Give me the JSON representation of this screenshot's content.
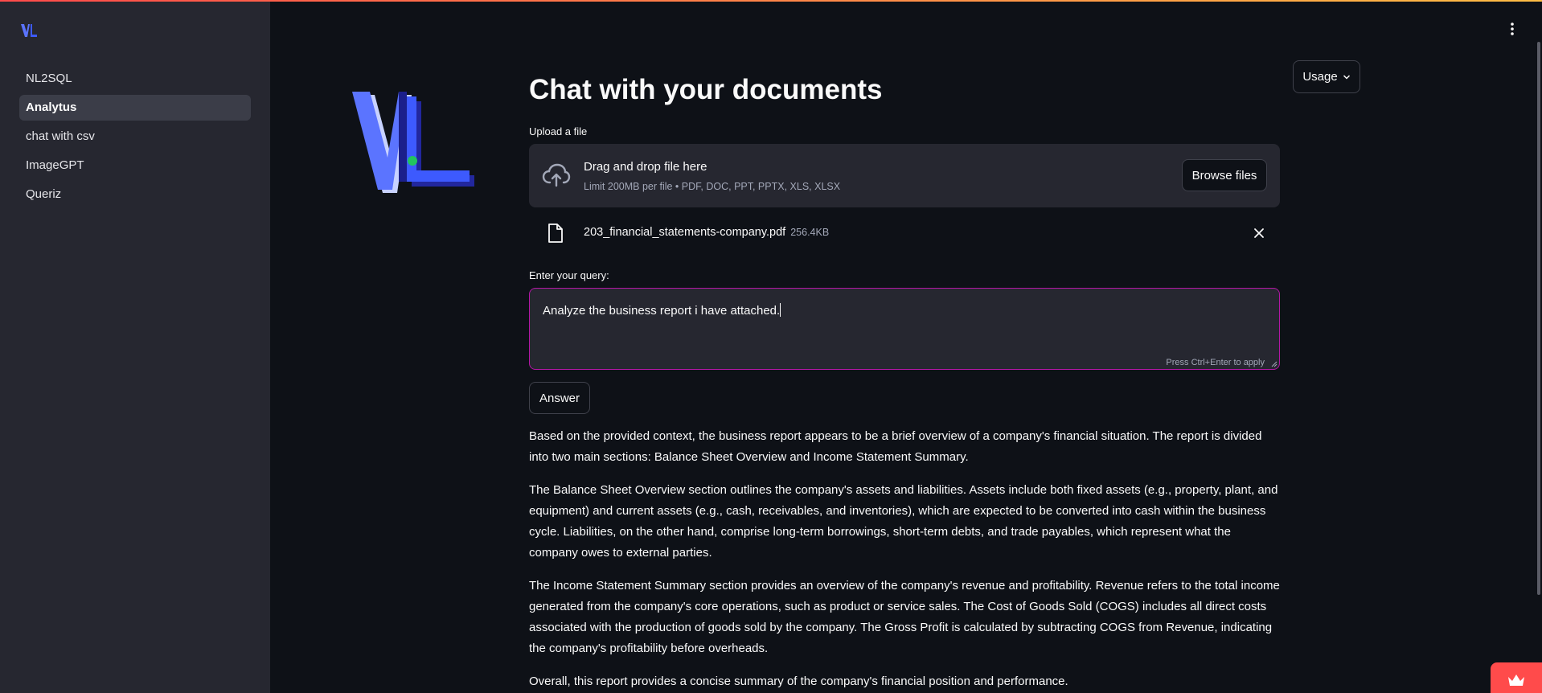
{
  "sidebar": {
    "items": [
      {
        "label": "NL2SQL",
        "active": false
      },
      {
        "label": "Analytus",
        "active": true
      },
      {
        "label": "chat with csv",
        "active": false
      },
      {
        "label": "ImageGPT",
        "active": false
      },
      {
        "label": "Queriz",
        "active": false
      }
    ]
  },
  "header": {
    "usage_label": "Usage",
    "title": "Chat with your documents"
  },
  "upload": {
    "label": "Upload a file",
    "drop_title": "Drag and drop file here",
    "drop_limits": "Limit 200MB per file • PDF, DOC, PPT, PPTX, XLS, XLSX",
    "browse_label": "Browse files",
    "file_name": "203_financial_statements-company.pdf",
    "file_size": "256.4KB"
  },
  "query": {
    "label": "Enter your query:",
    "value": "Analyze the business report i have attached.",
    "hint": "Press Ctrl+Enter to apply"
  },
  "answer_button_label": "Answer",
  "answer": {
    "paragraphs": [
      "Based on the provided context, the business report appears to be a brief overview of a company's financial situation. The report is divided into two main sections: Balance Sheet Overview and Income Statement Summary.",
      "The Balance Sheet Overview section outlines the company's assets and liabilities. Assets include both fixed assets (e.g., property, plant, and equipment) and current assets (e.g., cash, receivables, and inventories), which are expected to be converted into cash within the business cycle. Liabilities, on the other hand, comprise long-term borrowings, short-term debts, and trade payables, which represent what the company owes to external parties.",
      "The Income Statement Summary section provides an overview of the company's revenue and profitability. Revenue refers to the total income generated from the company's core operations, such as product or service sales. The Cost of Goods Sold (COGS) includes all direct costs associated with the production of goods sold by the company. The Gross Profit is calculated by subtracting COGS from Revenue, indicating the company's profitability before overheads.",
      "Overall, this report provides a concise summary of the company's financial position and performance."
    ]
  },
  "colors": {
    "background": "#0e1117",
    "sidebar": "#262730",
    "accent_focus": "#b417a6",
    "logo_blue": "#3d5afe",
    "badge": "#ff4b4b"
  },
  "icons": [
    "logo-icon",
    "cloud-upload-icon",
    "file-icon",
    "close-icon",
    "chevron-down-icon",
    "kebab-menu-icon",
    "crown-icon"
  ]
}
